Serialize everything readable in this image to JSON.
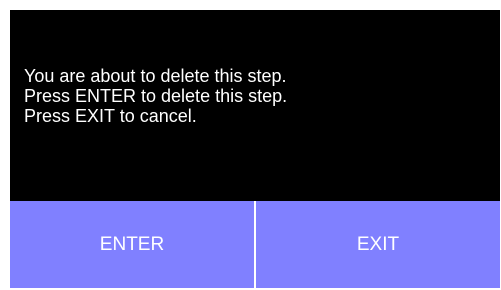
{
  "dialog": {
    "message_lines": [
      "You are about to delete this step.",
      "Press ENTER to delete this step.",
      "Press EXIT to cancel."
    ],
    "enter_label": "ENTER",
    "exit_label": "EXIT"
  },
  "colors": {
    "background": "#000000",
    "button": "#8080ff",
    "text": "#ffffff"
  }
}
